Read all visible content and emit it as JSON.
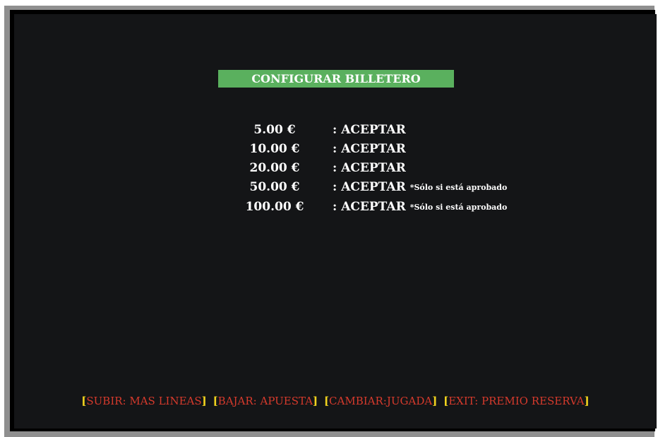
{
  "title": "CONFIGURAR BILLETERO",
  "rows": [
    {
      "amount": "5.00 €",
      "status": ": ACEPTAR",
      "note": ""
    },
    {
      "amount": "10.00 €",
      "status": ": ACEPTAR",
      "note": ""
    },
    {
      "amount": "20.00 €",
      "status": ": ACEPTAR",
      "note": ""
    },
    {
      "amount": "50.00 €",
      "status": ": ACEPTAR",
      "note": "*Sólo si está aprobado"
    },
    {
      "amount": "100.00 €",
      "status": ": ACEPTAR",
      "note": "*Sólo si está aprobado"
    }
  ],
  "footer": {
    "items": [
      {
        "label": "SUBIR: MAS LINEAS"
      },
      {
        "label": "BAJAR: APUESTA"
      },
      {
        "label": "CAMBIAR:JUGADA"
      },
      {
        "label": "EXIT: PREMIO RESERVA"
      }
    ],
    "bracket_open": "[",
    "bracket_close": "]"
  },
  "colors": {
    "screen_bg": "#141517",
    "title_bg": "#5ab05e",
    "text": "#ffffff",
    "bracket": "#f0d21e",
    "key_label": "#d63a2c",
    "bezel": "#8f8f8f"
  }
}
